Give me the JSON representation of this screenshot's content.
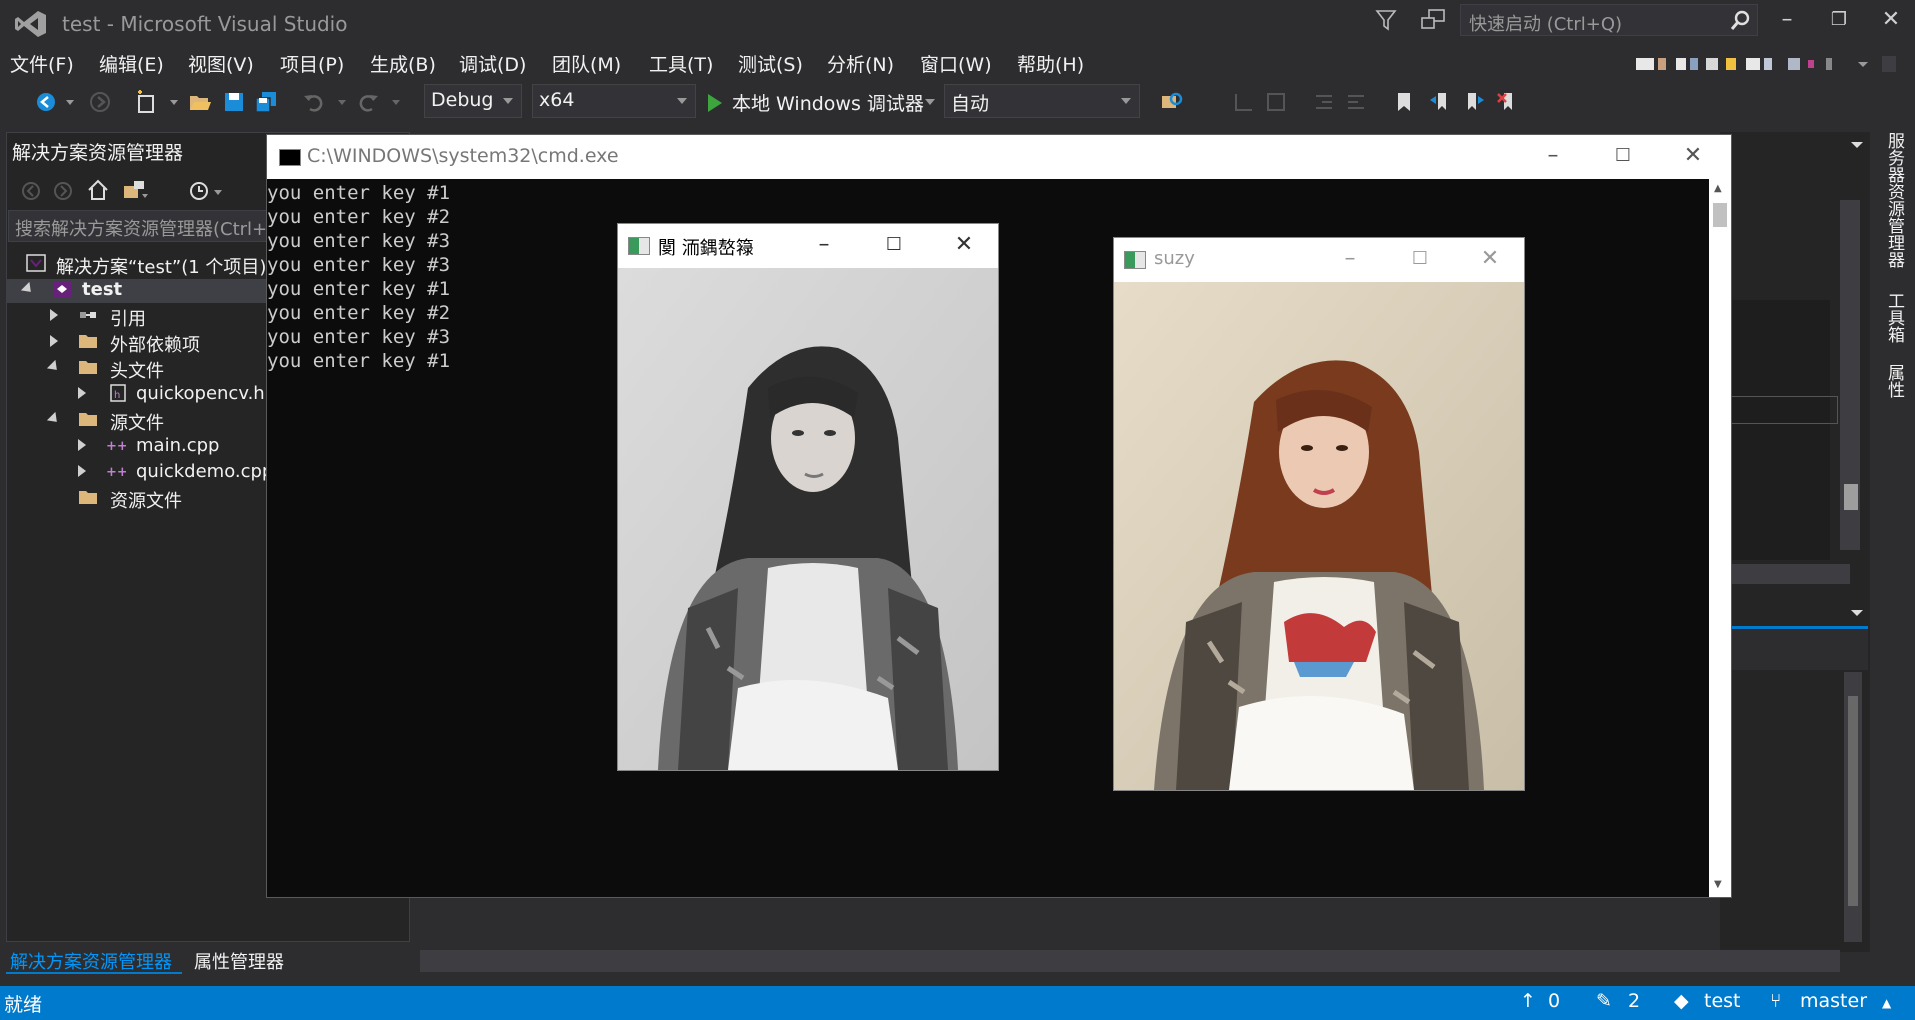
{
  "app": {
    "title": "test - Microsoft Visual Studio",
    "quick_launch_placeholder": "快速启动 (Ctrl+Q)"
  },
  "menu": [
    "文件(F)",
    "编辑(E)",
    "视图(V)",
    "项目(P)",
    "生成(B)",
    "调试(D)",
    "团队(M)",
    "工具(T)",
    "测试(S)",
    "分析(N)",
    "窗口(W)",
    "帮助(H)"
  ],
  "toolbar": {
    "config": "Debug",
    "platform": "x64",
    "run_label": "本地 Windows 调试器",
    "auto_combo": "自动"
  },
  "solution_explorer": {
    "title": "解决方案资源管理器",
    "search_placeholder": "搜索解决方案资源管理器(Ctrl+;)",
    "tree": [
      {
        "label": "解决方案“test”(1 个项目)",
        "level": 0,
        "icon": "solution-icon",
        "expander": "none"
      },
      {
        "label": "test",
        "level": 1,
        "icon": "project-icon",
        "expander": "expanded"
      },
      {
        "label": "引用",
        "level": 2,
        "icon": "references-icon",
        "expander": "collapsed"
      },
      {
        "label": "外部依赖项",
        "level": 2,
        "icon": "folder-icon",
        "expander": "collapsed"
      },
      {
        "label": "头文件",
        "level": 2,
        "icon": "folder-icon",
        "expander": "expanded"
      },
      {
        "label": "quickopencv.h",
        "level": 3,
        "icon": "header-file-icon",
        "expander": "collapsed"
      },
      {
        "label": "源文件",
        "level": 2,
        "icon": "folder-icon",
        "expander": "expanded"
      },
      {
        "label": "main.cpp",
        "level": 3,
        "icon": "cpp-file-icon",
        "expander": "collapsed"
      },
      {
        "label": "quickdemo.cpp",
        "level": 3,
        "icon": "cpp-file-icon",
        "expander": "collapsed"
      },
      {
        "label": "资源文件",
        "level": 2,
        "icon": "folder-icon",
        "expander": "none"
      }
    ],
    "bottom_tabs": [
      "解决方案资源管理器",
      "属性管理器"
    ]
  },
  "right_vertical_tabs": [
    "服务器资源管理器",
    "工具箱",
    "属性"
  ],
  "cmd": {
    "title": "C:\\WINDOWS\\system32\\cmd.exe",
    "lines": [
      "you enter key #1",
      "you enter key #2",
      "you enter key #3",
      "you enter key #3",
      "you enter key #1",
      "you enter key #2",
      "you enter key #3",
      "you enter key #1"
    ]
  },
  "cv_windows": [
    {
      "title": "閺 洏鍝嶅簶",
      "mode": "grayscale"
    },
    {
      "title": "suzy",
      "mode": "color"
    }
  ],
  "statusbar": {
    "ready": "就绪",
    "up_count": "0",
    "edit_count": "2",
    "repo": "test",
    "branch": "master"
  },
  "colors": {
    "accent": "#007acc",
    "background": "#2d2d30",
    "panel": "#252526"
  }
}
